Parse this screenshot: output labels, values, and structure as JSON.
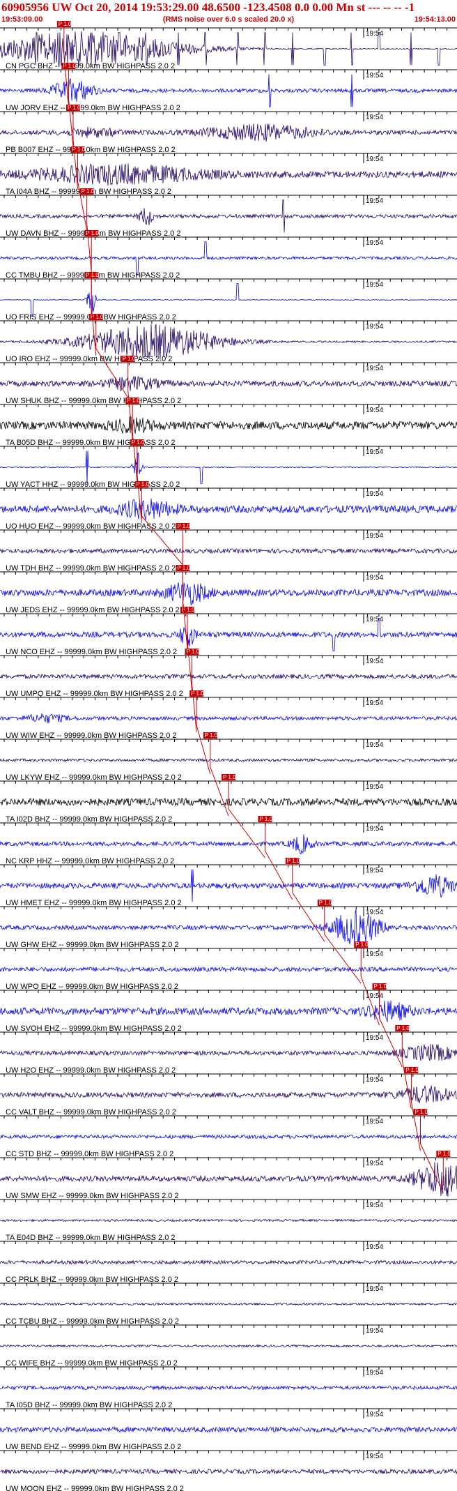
{
  "header": {
    "title": "60905956 UW Oct 20, 2014 19:53:29.00   48.6500 -123.4508  0.0 0.00 Mn st --- -- --   -1",
    "start_time": "19:53:09.00",
    "subtitle": "(RMS noise over 6.0 s scaled 20.0 x)",
    "end_time": "19:54:13.00"
  },
  "minute_tick_label": "19:54",
  "pick_label": "P 1.0",
  "colors": {
    "header_text": "#cc0000",
    "pick": "#cc0000",
    "trace_blue": "#0000ee",
    "trace_navy": "#220066",
    "trace_black": "#000000",
    "gridline": "#000000"
  },
  "traces": [
    {
      "label": "CN PGC BHZ -- 99999.0km BW  HIGHPASS  2.0  2",
      "color": "#220066",
      "pick": 0.14,
      "bursts": [
        {
          "c": 0.18,
          "a": 0.95,
          "w": 0.15
        }
      ],
      "spikes": [
        0.08,
        0.13,
        0.2,
        0.26,
        0.32,
        0.39,
        0.45,
        0.52,
        0.58,
        0.64,
        0.71,
        0.77,
        0.83,
        0.9,
        0.96
      ],
      "noise": 0.03
    },
    {
      "label": "UW JORV EHZ -- 99999.0km BW  HIGHPASS  2.0  2",
      "color": "#0000ee",
      "pick": 0.15,
      "bursts": [
        {
          "c": 0.16,
          "a": 0.6,
          "w": 0.03
        }
      ],
      "spikes": [
        0.59,
        0.77
      ],
      "noise": 0.1
    },
    {
      "label": "PB B007 EHZ -- 99999.0km BW  HIGHPASS  2.0  2",
      "color": "#220066",
      "pick": 0.16,
      "bursts": [
        {
          "c": 0.57,
          "a": 0.4,
          "w": 0.08
        },
        {
          "c": 0.2,
          "a": 0.2,
          "w": 0.04
        }
      ],
      "spikes": [],
      "noise": 0.12
    },
    {
      "label": "TA I04A BHZ -- 99999.0km BW  HIGHPASS  2.0  2",
      "color": "#220066",
      "pick": 0.17,
      "bursts": [
        {
          "c": 0.26,
          "a": 0.45,
          "w": 0.12
        }
      ],
      "spikes": [],
      "noise": 0.18
    },
    {
      "label": "UW DAVN BHZ -- 99999.0km BW  HIGHPASS  2.0  2",
      "color": "#220066",
      "pick": 0.19,
      "bursts": [
        {
          "c": 0.32,
          "a": 0.5,
          "w": 0.01
        }
      ],
      "spikes": [
        0.62
      ],
      "noise": 0.1
    },
    {
      "label": "CC TMBU BHZ -- 99999.0km BW  HIGHPASS  2.0  2",
      "color": "#0000ee",
      "pick": 0.2,
      "bursts": [],
      "spikes": [
        0.3,
        0.45
      ],
      "noise": 0.08
    },
    {
      "label": "UO FRIS EHZ -- 99999.0km BW  HIGHPASS  2.0  2",
      "color": "#0000ee",
      "pick": 0.2,
      "bursts": [
        {
          "c": 0.2,
          "a": 0.9,
          "w": 0.006
        }
      ],
      "spikes": [
        0.07,
        0.52
      ],
      "noise": 0.02
    },
    {
      "label": "UO IRO EHZ -- 99999.0km BW  HIGHPASS  2.0  2",
      "color": "#220066",
      "pick": 0.21,
      "bursts": [
        {
          "c": 0.33,
          "a": 0.95,
          "w": 0.1
        }
      ],
      "spikes": [],
      "noise": 0.05
    },
    {
      "label": "UW SHUK BHZ -- 99999.0km BW  HIGHPASS  2.0  2",
      "color": "#220066",
      "pick": 0.28,
      "bursts": [
        {
          "c": 0.29,
          "a": 0.3,
          "w": 0.04
        }
      ],
      "spikes": [],
      "noise": 0.15
    },
    {
      "label": "TA B05D BHZ -- 99999.0km BW  HIGHPASS  2.0  2",
      "color": "#000000",
      "pick": 0.29,
      "bursts": [
        {
          "c": 0.29,
          "a": 0.3,
          "w": 0.03
        }
      ],
      "spikes": [],
      "noise": 0.22
    },
    {
      "label": "UW YACT HHZ -- 99999.0km BW  HIGHPASS  2.0  2",
      "color": "#0000ee",
      "pick": 0.3,
      "bursts": [
        {
          "c": 0.3,
          "a": 0.85,
          "w": 0.006
        }
      ],
      "spikes": [
        0.19,
        0.44
      ],
      "noise": 0.03
    },
    {
      "label": "UO HUO EHZ -- 99999.0km BW  HIGHPASS  2.0  2",
      "color": "#0000ee",
      "pick": 0.31,
      "bursts": [
        {
          "c": 0.32,
          "a": 0.45,
          "w": 0.04
        }
      ],
      "spikes": [],
      "noise": 0.2
    },
    {
      "label": "UW TDH BHZ -- 99999.0km BW  HIGHPASS  2.0  2",
      "color": "#220066",
      "pick": 0.4,
      "bursts": [],
      "spikes": [],
      "noise": 0.12
    },
    {
      "label": "UW JEDS EHZ -- 99999.0km BW  HIGHPASS  2.0  2",
      "color": "#0000ee",
      "pick": 0.4,
      "bursts": [
        {
          "c": 0.41,
          "a": 0.55,
          "w": 0.03
        }
      ],
      "spikes": [],
      "noise": 0.18
    },
    {
      "label": "UW NCO EHZ -- 99999.0km BW  HIGHPASS  2.0  2",
      "color": "#0000ee",
      "pick": 0.41,
      "bursts": [
        {
          "c": 0.41,
          "a": 0.7,
          "w": 0.01
        }
      ],
      "spikes": [
        0.73,
        0.83
      ],
      "noise": 0.15
    },
    {
      "label": "UW UMPQ EHZ -- 99999.0km BW  HIGHPASS  2.0  2",
      "color": "#220066",
      "pick": 0.42,
      "bursts": [],
      "spikes": [],
      "noise": 0.12
    },
    {
      "label": "UW WIW EHZ -- 99999.0km BW  HIGHPASS  2.0  2",
      "color": "#0000ee",
      "pick": 0.43,
      "bursts": [
        {
          "c": 0.1,
          "a": 0.2,
          "w": 0.03
        }
      ],
      "spikes": [],
      "noise": 0.1
    },
    {
      "label": "UW LKYW EHZ -- 99999.0km BW  HIGHPASS  2.0  2",
      "color": "#220066",
      "pick": 0.46,
      "bursts": [],
      "spikes": [],
      "noise": 0.08
    },
    {
      "label": "TA I02D BHZ -- 99999.0km BW  HIGHPASS  2.0  2",
      "color": "#000000",
      "pick": 0.5,
      "bursts": [],
      "spikes": [],
      "noise": 0.2
    },
    {
      "label": "NC KRP HHZ -- 99999.0km BW  HIGHPASS  2.0  2",
      "color": "#0000ee",
      "pick": 0.58,
      "bursts": [
        {
          "c": 0.66,
          "a": 0.45,
          "w": 0.015
        }
      ],
      "spikes": [],
      "noise": 0.12
    },
    {
      "label": "UW HMET EHZ -- 99999.0km BW  HIGHPASS  2.0  2",
      "color": "#0000ee",
      "pick": 0.64,
      "bursts": [
        {
          "c": 0.95,
          "a": 0.55,
          "w": 0.03
        }
      ],
      "spikes": [
        0.42
      ],
      "noise": 0.15
    },
    {
      "label": "UW GHW EHZ -- 99999.0km BW  HIGHPASS  2.0  2",
      "color": "#0000ee",
      "pick": 0.71,
      "bursts": [
        {
          "c": 0.78,
          "a": 0.95,
          "w": 0.035
        }
      ],
      "spikes": [],
      "noise": 0.12
    },
    {
      "label": "UW WPO EHZ -- 99999.0km BW  HIGHPASS  2.0  2",
      "color": "#0000ee",
      "pick": 0.79,
      "bursts": [],
      "spikes": [],
      "noise": 0.12
    },
    {
      "label": "UW SVOH EHZ -- 99999.0km BW  HIGHPASS  2.0  2",
      "color": "#0000ee",
      "pick": 0.83,
      "bursts": [
        {
          "c": 0.85,
          "a": 0.45,
          "w": 0.03
        }
      ],
      "spikes": [],
      "noise": 0.2
    },
    {
      "label": "UW H2O EHZ -- 99999.0km BW  HIGHPASS  2.0  2",
      "color": "#220066",
      "pick": 0.88,
      "bursts": [
        {
          "c": 0.94,
          "a": 0.4,
          "w": 0.04
        }
      ],
      "spikes": [],
      "noise": 0.12
    },
    {
      "label": "CC VALT BHZ -- 99999.0km BW  HIGHPASS  2.0  2",
      "color": "#220066",
      "pick": 0.9,
      "bursts": [
        {
          "c": 0.93,
          "a": 0.4,
          "w": 0.04
        }
      ],
      "spikes": [],
      "noise": 0.14
    },
    {
      "label": "CC STD BHZ -- 99999.0km BW  HIGHPASS  2.0  2",
      "color": "#0000ee",
      "pick": 0.92,
      "bursts": [],
      "spikes": [],
      "noise": 0.1
    },
    {
      "label": "UW SMW EHZ -- 99999.0km BW  HIGHPASS  2.0  2",
      "color": "#220066",
      "pick": 0.97,
      "bursts": [
        {
          "c": 0.97,
          "a": 0.95,
          "w": 0.04
        }
      ],
      "spikes": [],
      "noise": 0.15
    },
    {
      "label": "TA E04D BHZ -- 99999.0km BW  HIGHPASS  2.0  2",
      "color": "#220066",
      "pick": null,
      "bursts": [],
      "spikes": [],
      "noise": 0.06
    },
    {
      "label": "CC PRLK BHZ -- 99999.0km BW  HIGHPASS  2.0  2",
      "color": "#220066",
      "pick": null,
      "bursts": [],
      "spikes": [],
      "noise": 0.1
    },
    {
      "label": "CC TCBU BHZ -- 99999.0km BW  HIGHPASS  2.0  2",
      "color": "#220066",
      "pick": null,
      "bursts": [],
      "spikes": [],
      "noise": 0.06
    },
    {
      "label": "CC WIFE BHZ -- 99999.0km BW  HIGHPASS  2.0  2",
      "color": "#220066",
      "pick": null,
      "bursts": [],
      "spikes": [],
      "noise": 0.06
    },
    {
      "label": "TA I05D BHZ -- 99999.0km BW  HIGHPASS  2.0  2",
      "color": "#0000ee",
      "pick": null,
      "bursts": [],
      "spikes": [],
      "noise": 0.1
    },
    {
      "label": "UW BEND EHZ -- 99999.0km BW  HIGHPASS  2.0  2",
      "color": "#0000ee",
      "pick": null,
      "bursts": [],
      "spikes": [],
      "noise": 0.14
    },
    {
      "label": "UW MOON EHZ -- 99999.0km BW  HIGHPASS  2.0  2",
      "color": "#220066",
      "pick": null,
      "bursts": [],
      "spikes": [],
      "noise": 0.12
    }
  ]
}
